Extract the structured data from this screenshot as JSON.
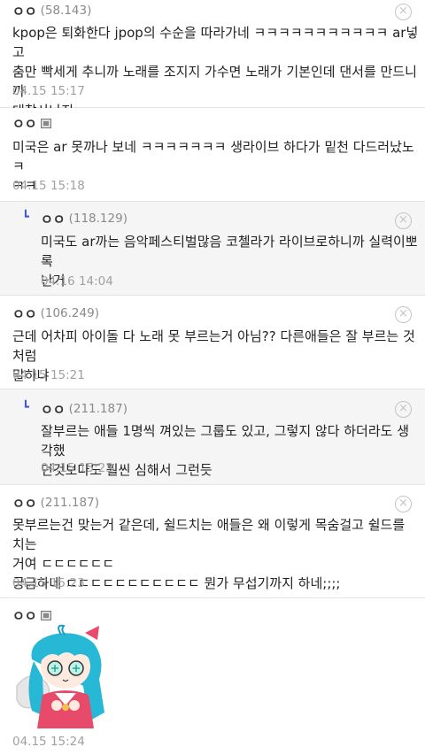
{
  "comments": [
    {
      "nick": "ㅇㅇ",
      "ip": "(58.143)",
      "text": "kpop은 퇴화한다 jpop의 수순을 따라가네 ㅋㅋㅋㅋㅋㅋㅋㅋㅋㅋㅋ ar넣고\n춤만 빡세게 추니까 노래를 조지지 가수면 노래가 기본인데 댄서를 만드니까\n대참사나지",
      "date": "04.15 15:17"
    },
    {
      "nick": "ㅇㅇ",
      "ip": "",
      "text": "미국은 ar 못까나 보네 ㅋㅋㅋㅋㅋㅋㅋ 생라이브 하다가 밑천 다드러났노 ㅋ\nㅋㅋ",
      "date": "04.15 15:18"
    },
    {
      "nick": "ㅇㅇ",
      "ip": "(118.129)",
      "text": "미국도 ar까는 음악페스티벌많음 코첼라가 라이브로하니까 실력이뽀록\n난거",
      "date": "04.16 14:04"
    },
    {
      "nick": "ㅇㅇ",
      "ip": "(106.249)",
      "text": "근데 어차피 아이돌 다 노래 못 부르는거 아님?? 다른애들은 잘 부르는 것처럼\n말하냐",
      "date": "04.15 15:21"
    },
    {
      "nick": "ㅇㅇ",
      "ip": "(211.187)",
      "text": "잘부르는 애들 1명씩 껴있는 그룹도 있고, 그렇지 않다 하더라도 생각했\n던것보다도 훨씬 심해서 그런듯",
      "date": "04.15 15:23"
    },
    {
      "nick": "ㅇㅇ",
      "ip": "(211.187)",
      "text": "못부르는건 맞는거 같은데, 쉴드치는 애들은 왜 이렇게 목숨걸고 쉴드를 치는\n거여 ㄷㄷㄷㄷㄷㄷ\n궁금하네 ㄷㄷㄷㄷㄷㄷㄷㄷㄷㄷㄷ 뭔가 무섭기까지 하네;;;;",
      "date": "04.15 15:23"
    },
    {
      "nick": "ㅇㅇ",
      "ip": "",
      "text": "",
      "date": "04.15 15:24"
    }
  ],
  "icons": {
    "delete": "circle-x-icon",
    "reply": "reply-arrow-icon",
    "writer": "gallery-writer-icon"
  },
  "colors": {
    "reply_bg": "#f5f5f5",
    "divider": "#e4e4e4",
    "reply_arrow": "#3b5bd6"
  }
}
